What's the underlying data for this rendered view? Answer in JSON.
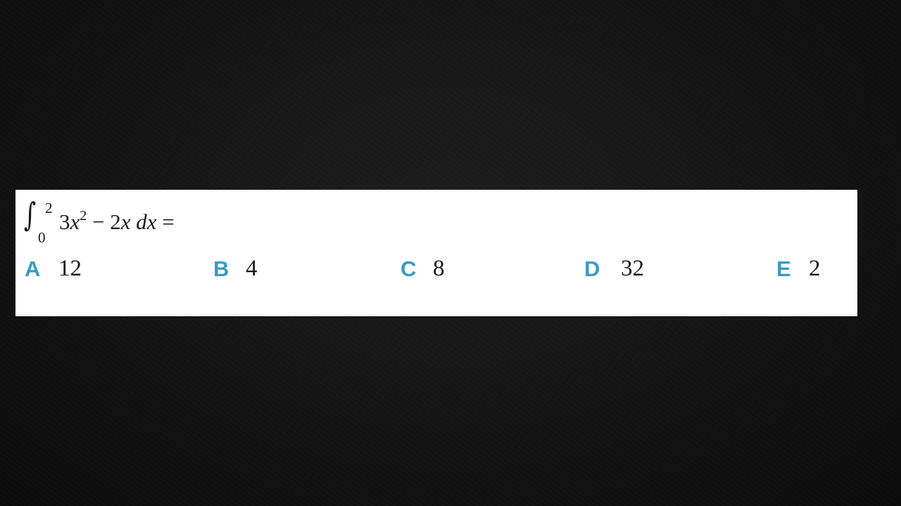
{
  "question": {
    "integral_sign": "∫",
    "upper_limit": "2",
    "lower_limit": "0",
    "integrand": {
      "coef1": "3",
      "var1": "x",
      "exp1": "2",
      "op": " − ",
      "coef2": "2",
      "var2": "x",
      "differential": " dx ",
      "equals": "="
    }
  },
  "choices": [
    {
      "letter": "A",
      "value": "12"
    },
    {
      "letter": "B",
      "value": "4"
    },
    {
      "letter": "C",
      "value": "8"
    },
    {
      "letter": "D",
      "value": "32"
    },
    {
      "letter": "E",
      "value": "2"
    }
  ],
  "colors": {
    "background": "#141414",
    "card": "#ffffff",
    "choice_letter": "#3a9dc0",
    "text": "#1a1a1a"
  }
}
